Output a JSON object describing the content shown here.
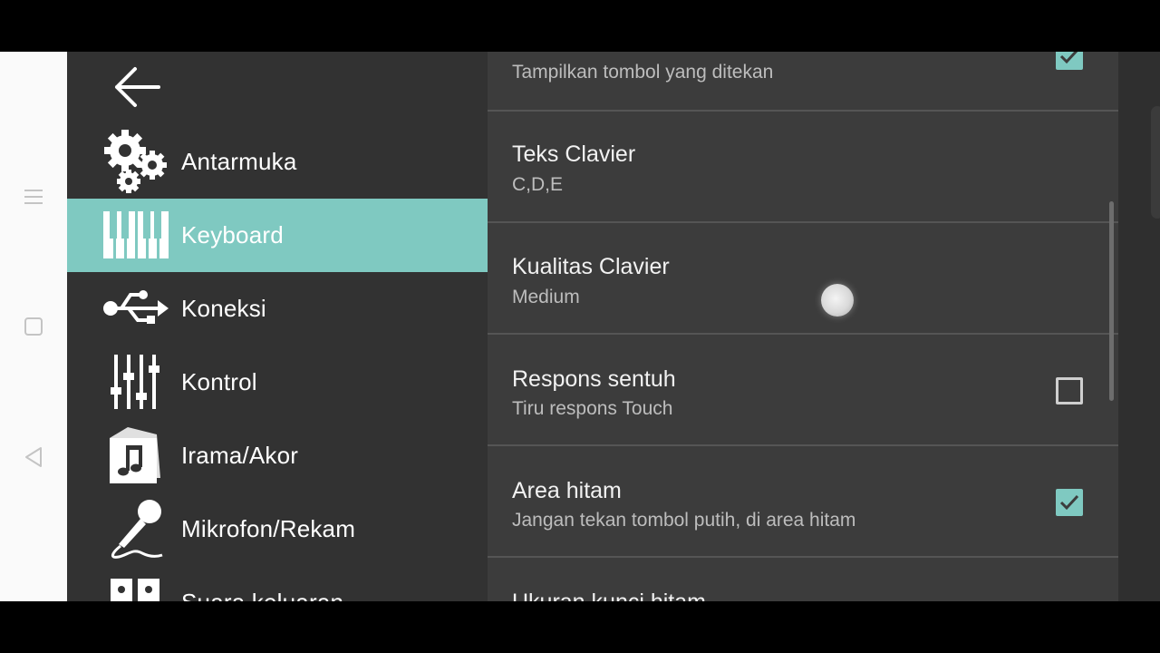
{
  "drawer": {
    "items": [
      {
        "label": "Antarmuka",
        "icon": "gears-icon"
      },
      {
        "label": "Keyboard",
        "icon": "piano-keys-icon",
        "active": true
      },
      {
        "label": "Koneksi",
        "icon": "usb-icon"
      },
      {
        "label": "Kontrol",
        "icon": "sliders-icon"
      },
      {
        "label": "Irama/Akor",
        "icon": "music-note-icon"
      },
      {
        "label": "Mikrofon/Rekam",
        "icon": "microphone-icon"
      },
      {
        "label": "Suara keluaran",
        "icon": "speakers-icon"
      }
    ]
  },
  "settings": {
    "rows": [
      {
        "title": "",
        "subtitle": "Tampilkan tombol yang ditekan",
        "checkbox": "checked"
      },
      {
        "title": "Teks Clavier",
        "subtitle": "C,D,E"
      },
      {
        "title": "Kualitas Clavier",
        "subtitle": "Medium"
      },
      {
        "title": "Respons sentuh",
        "subtitle": "Tiru respons Touch",
        "checkbox": "unchecked"
      },
      {
        "title": "Area hitam",
        "subtitle": "Jangan tekan tombol putih, di area hitam",
        "checkbox": "checked"
      },
      {
        "title": "Ukuran kunci hitam",
        "subtitle": ""
      }
    ]
  },
  "colors": {
    "accent": "#7fc9c1",
    "drawer_bg": "#323232",
    "list_bg": "#3c3c3c",
    "navbar_bg": "#fafafa"
  }
}
